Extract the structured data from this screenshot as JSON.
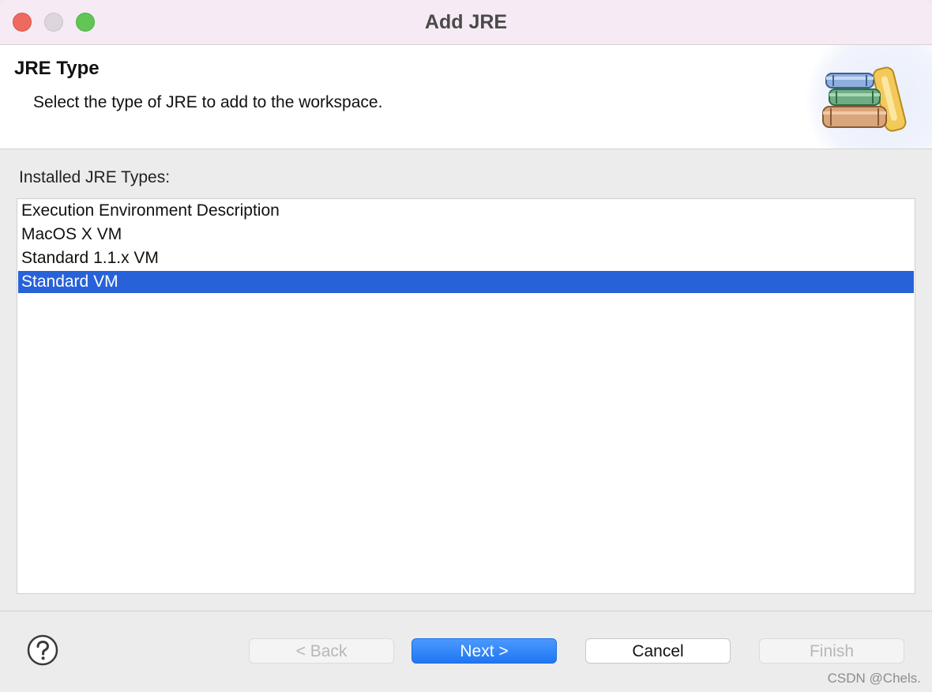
{
  "window": {
    "title": "Add JRE"
  },
  "header": {
    "heading": "JRE Type",
    "description": "Select the type of JRE to add to the workspace.",
    "icon": "jre-books-icon"
  },
  "main": {
    "list_label": "Installed JRE Types:",
    "items": [
      {
        "label": "Execution Environment Description",
        "selected": false
      },
      {
        "label": "MacOS X VM",
        "selected": false
      },
      {
        "label": "Standard 1.1.x VM",
        "selected": false
      },
      {
        "label": "Standard VM",
        "selected": true
      }
    ]
  },
  "footer": {
    "help_icon": "help-icon",
    "back_label": "< Back",
    "next_label": "Next >",
    "cancel_label": "Cancel",
    "finish_label": "Finish"
  },
  "watermark": "CSDN @Chels.",
  "colors": {
    "selection": "#2862d9",
    "primary_button": "#2a7cf4",
    "titlebar": "#f6ebf4"
  }
}
